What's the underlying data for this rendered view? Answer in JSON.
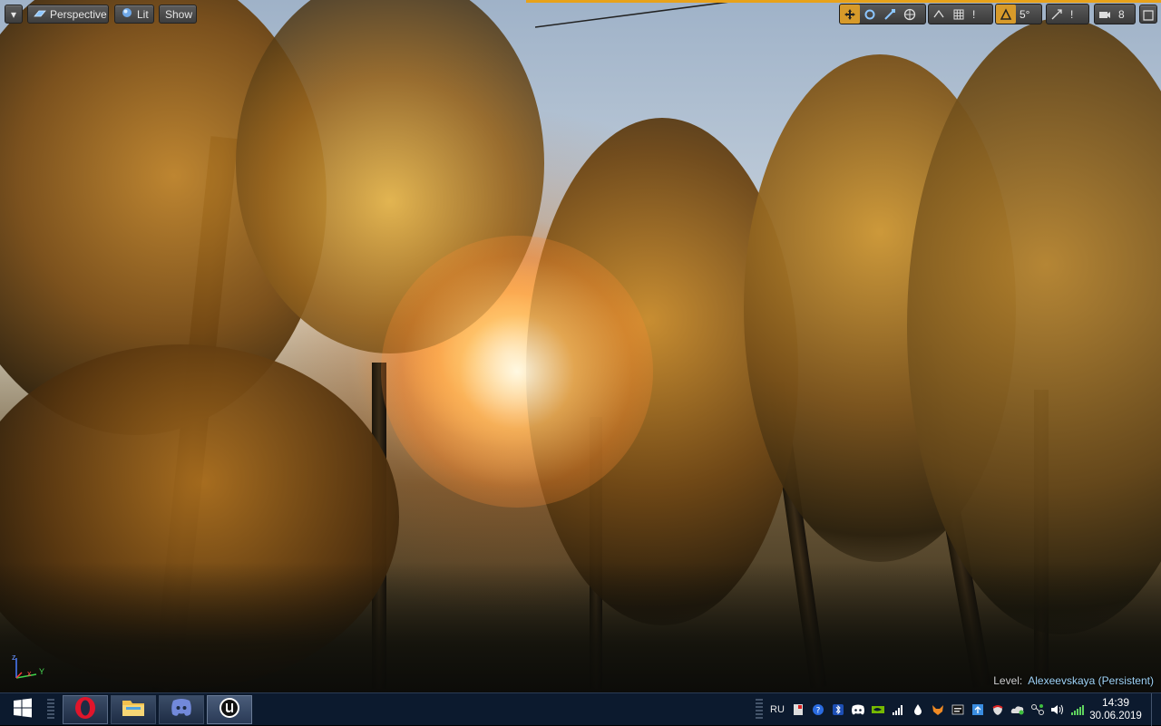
{
  "viewport": {
    "menu_label": "▾",
    "perspective_label": "Perspective",
    "lit_label": "Lit",
    "show_label": "Show",
    "toolbar": {
      "icons": [
        "move-icon",
        "rotate-icon",
        "scale-icon",
        "world-local-icon",
        "surface-snap-icon",
        "grid-snap-icon"
      ],
      "grid_value": "!",
      "angle_value": "5°",
      "scale_value": "!",
      "camera_speed": "8"
    },
    "level_prefix": "Level:",
    "level_name": "Alexeevskaya (Persistent)",
    "axis": {
      "x": "x",
      "y": "Y",
      "z": "z"
    }
  },
  "taskbar": {
    "apps": [
      "opera-app",
      "file-explorer-app",
      "discord-app",
      "unreal-engine-app"
    ],
    "language": "RU",
    "time": "14:39",
    "date": "30.06.2019"
  },
  "colors": {
    "toolbar_active": "#d79a2a",
    "level_name": "#9fd3f7",
    "taskbar_bg": "#0c1a2e"
  }
}
